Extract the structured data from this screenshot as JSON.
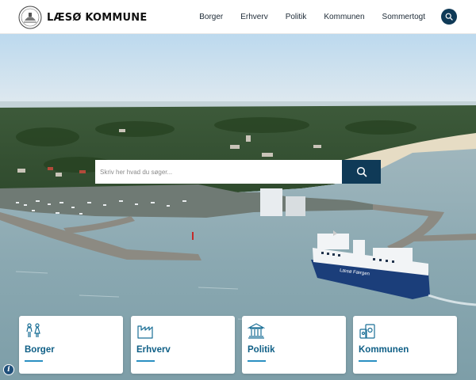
{
  "header": {
    "logo_text": "LÆSØ KOMMUNE",
    "nav": [
      "Borger",
      "Erhverv",
      "Politik",
      "Kommunen",
      "Sommertogt"
    ],
    "search_icon": "search-icon"
  },
  "search": {
    "placeholder": "Skriv her hvad du søger...",
    "submit_icon": "search-icon"
  },
  "cards": [
    {
      "label": "Borger",
      "icon": "people-icon"
    },
    {
      "label": "Erhverv",
      "icon": "factory-icon"
    },
    {
      "label": "Politik",
      "icon": "townhall-icon"
    },
    {
      "label": "Kommunen",
      "icon": "buildings-icon"
    }
  ],
  "ferry_name": "Læsø Færgen",
  "colors": {
    "primary": "#0f3a57",
    "link": "#0f5f86",
    "accent": "#2a8fc2"
  }
}
